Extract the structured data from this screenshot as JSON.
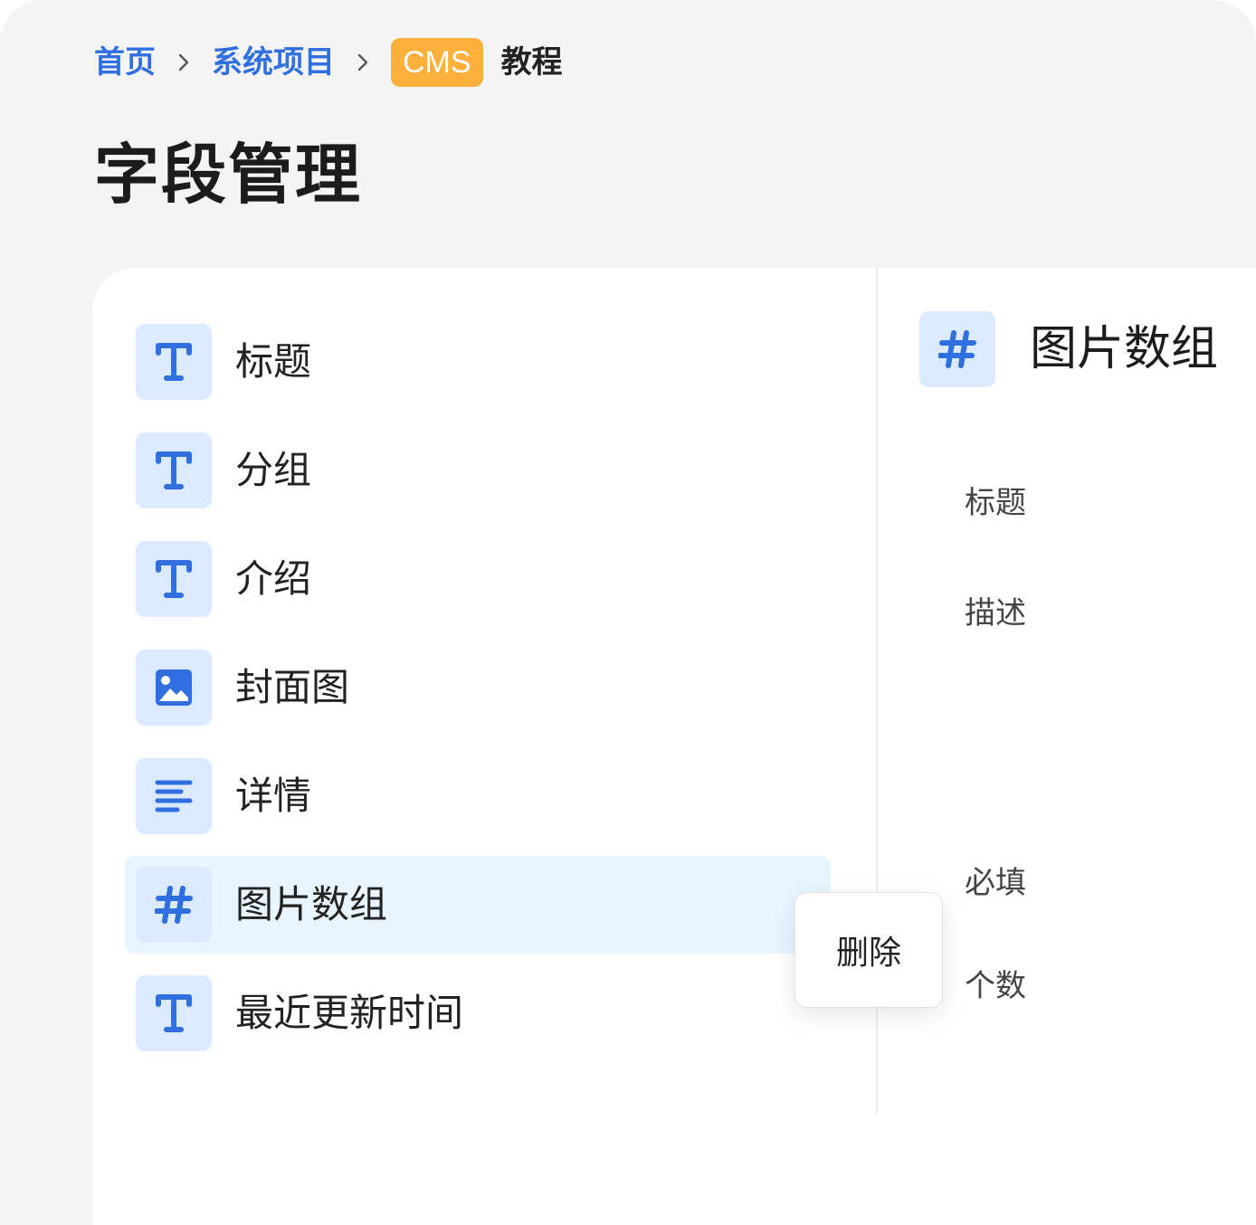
{
  "breadcrumb": {
    "home": "首页",
    "project": "系统项目",
    "badge": "CMS",
    "current": "教程"
  },
  "page_title": "字段管理",
  "fields": [
    {
      "label": "标题",
      "icon": "text-type-icon",
      "selected": false
    },
    {
      "label": "分组",
      "icon": "text-type-icon",
      "selected": false
    },
    {
      "label": "介绍",
      "icon": "text-type-icon",
      "selected": false
    },
    {
      "label": "封面图",
      "icon": "image-icon",
      "selected": false
    },
    {
      "label": "详情",
      "icon": "paragraph-icon",
      "selected": false
    },
    {
      "label": "图片数组",
      "icon": "hash-icon",
      "selected": true
    },
    {
      "label": "最近更新时间",
      "icon": "text-type-icon",
      "selected": false
    }
  ],
  "context_menu": {
    "delete_label": "删除"
  },
  "detail": {
    "title": "图片数组",
    "icon": "hash-icon",
    "properties": {
      "title": "标题",
      "description": "描述",
      "required": "必填",
      "count": "个数"
    }
  },
  "colors": {
    "accent": "#2f6fe0",
    "badge": "#fbb03b",
    "icon_tile": "#dbeafe",
    "selected_row": "#e8f4ff",
    "background": "#f4f4f4"
  }
}
